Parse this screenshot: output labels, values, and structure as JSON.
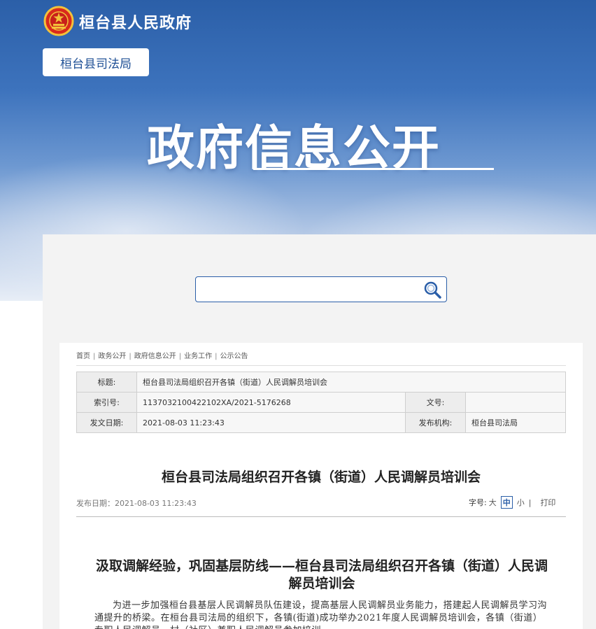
{
  "header": {
    "gov_name": "桓台县人民政府",
    "dept_label": "桓台县司法局",
    "big_title": "政府信息公开"
  },
  "search": {
    "placeholder": ""
  },
  "breadcrumb": [
    "首页",
    "政务公开",
    "政府信息公开",
    "业务工作",
    "公示公告"
  ],
  "meta": {
    "title_label": "标题:",
    "title_value": "桓台县司法局组织召开各镇（街道）人民调解员培训会",
    "index_label": "索引号:",
    "index_value": "1137032100422102XA/2021-5176268",
    "docno_label": "文号:",
    "docno_value": "",
    "date_label": "发文日期:",
    "date_value": "2021-08-03 11:23:43",
    "org_label": "发布机构:",
    "org_value": "桓台县司法局"
  },
  "article": {
    "title": "桓台县司法局组织召开各镇（街道）人民调解员培训会",
    "pub_date": "发布日期：2021-08-03 11:23:43",
    "font_label": "字号:",
    "font_large": "大",
    "font_medium": "中",
    "font_small": "小",
    "font_sep": "|",
    "print": "打印",
    "subtitle": "汲取调解经验，巩固基层防线——桓台县司法局组织召开各镇（街道）人民调解员培训会",
    "body": "为进一步加强桓台县基层人民调解员队伍建设，提高基层人民调解员业务能力，搭建起人民调解员学习沟通提升的桥梁。在桓台县司法局的组织下，各镇(街道)成功举办2021年度人民调解员培训会，各镇（街道）专职人民调解员、村（社区）兼职人民调解员参加培训。"
  },
  "colors": {
    "brand_blue": "#2a5ea8",
    "panel_bg": "#f3f3f3"
  }
}
